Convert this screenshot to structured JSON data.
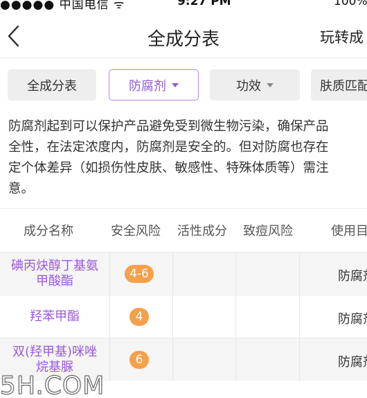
{
  "status_bar": {
    "carrier": "●●●●● 中国电信 ᯤ",
    "time": "9:27 PM",
    "battery": "100%"
  },
  "nav": {
    "title": "全成分表",
    "right_label": "玩转成"
  },
  "filters": [
    {
      "label": "全成分表",
      "active": false
    },
    {
      "label": "防腐剂",
      "active": true
    },
    {
      "label": "功效",
      "active": false
    },
    {
      "label": "肤质匹配",
      "active": false
    }
  ],
  "description": {
    "lines": [
      "防腐剂起到可以保护产品避免受到微生物污染，确保产品",
      "全性，在法定浓度内，防腐剂是安全的。但对防腐也存在",
      "定个体差异（如损伤性皮肤、敏感性、特殊体质等）需注",
      "意。"
    ]
  },
  "table": {
    "headers": {
      "name": "成分名称",
      "safety": "安全风险",
      "active": "活性成分",
      "acne": "致痘风险",
      "use": "使用目"
    },
    "rows": [
      {
        "name_line1": "碘丙炔醇丁基氨",
        "name_line2": "甲酸酯",
        "risk": "4-6",
        "use": "防腐剂"
      },
      {
        "name_line1": "羟苯甲酯",
        "name_line2": "",
        "risk": "4",
        "use": "防腐剂"
      },
      {
        "name_line1": "双(羟甲基)咪唑",
        "name_line2": "烷基脲",
        "risk": "6",
        "use": "防腐剂"
      }
    ]
  },
  "watermark": "5H.COM",
  "colors": {
    "accent": "#9a5ad8",
    "risk_badge": "#f5a04a"
  }
}
